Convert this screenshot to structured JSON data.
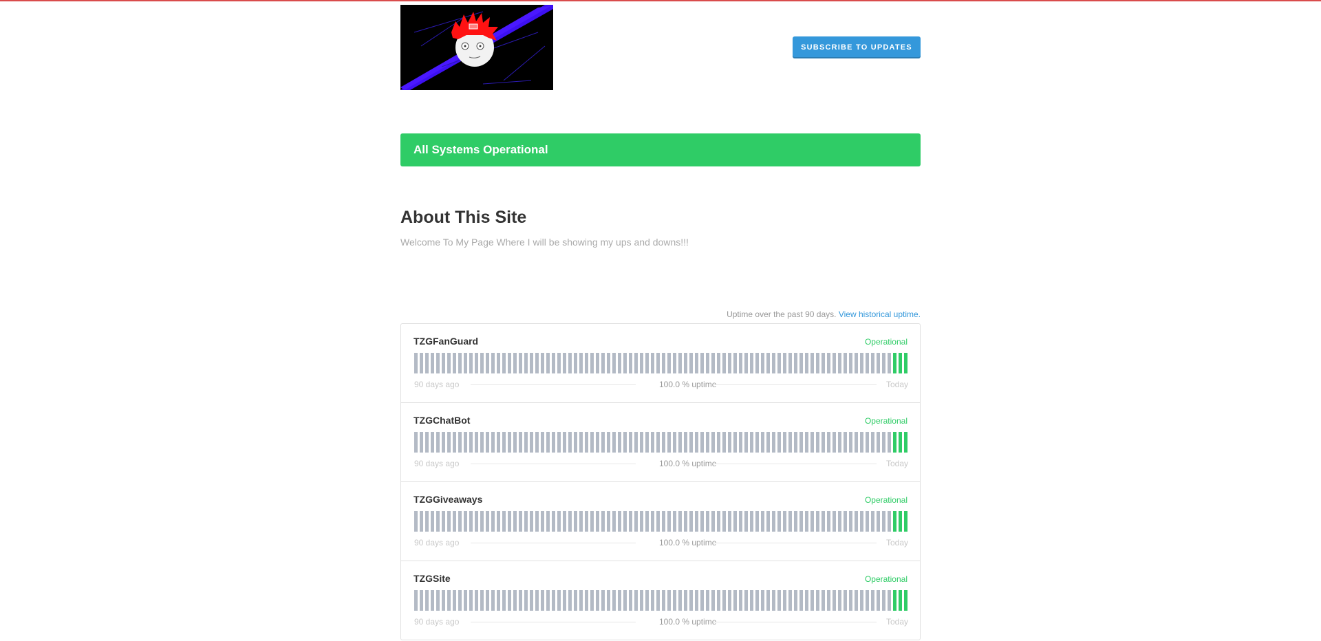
{
  "header": {
    "subscribe_label": "SUBSCRIBE TO UPDATES"
  },
  "status_banner": {
    "text": "All Systems Operational",
    "color": "#2fcc66"
  },
  "about": {
    "title": "About This Site",
    "text": "Welcome To My Page Where I will be showing my ups and downs!!!"
  },
  "uptime": {
    "note": "Uptime over the past 90 days.",
    "link": "View historical uptime."
  },
  "colors": {
    "accent": "#3498db",
    "operational": "#2fcc66",
    "no_data_bar": "#b3bac5"
  },
  "components": [
    {
      "name": "TZGFanGuard",
      "status": "Operational",
      "uptime": "100.0 % uptime",
      "left": "90 days ago",
      "right": "Today",
      "days_total": 90,
      "days_up": 3
    },
    {
      "name": "TZGChatBot",
      "status": "Operational",
      "uptime": "100.0 % uptime",
      "left": "90 days ago",
      "right": "Today",
      "days_total": 90,
      "days_up": 3
    },
    {
      "name": "TZGGiveaways",
      "status": "Operational",
      "uptime": "100.0 % uptime",
      "left": "90 days ago",
      "right": "Today",
      "days_total": 90,
      "days_up": 3
    },
    {
      "name": "TZGSite",
      "status": "Operational",
      "uptime": "100.0 % uptime",
      "left": "90 days ago",
      "right": "Today",
      "days_total": 90,
      "days_up": 3
    }
  ]
}
